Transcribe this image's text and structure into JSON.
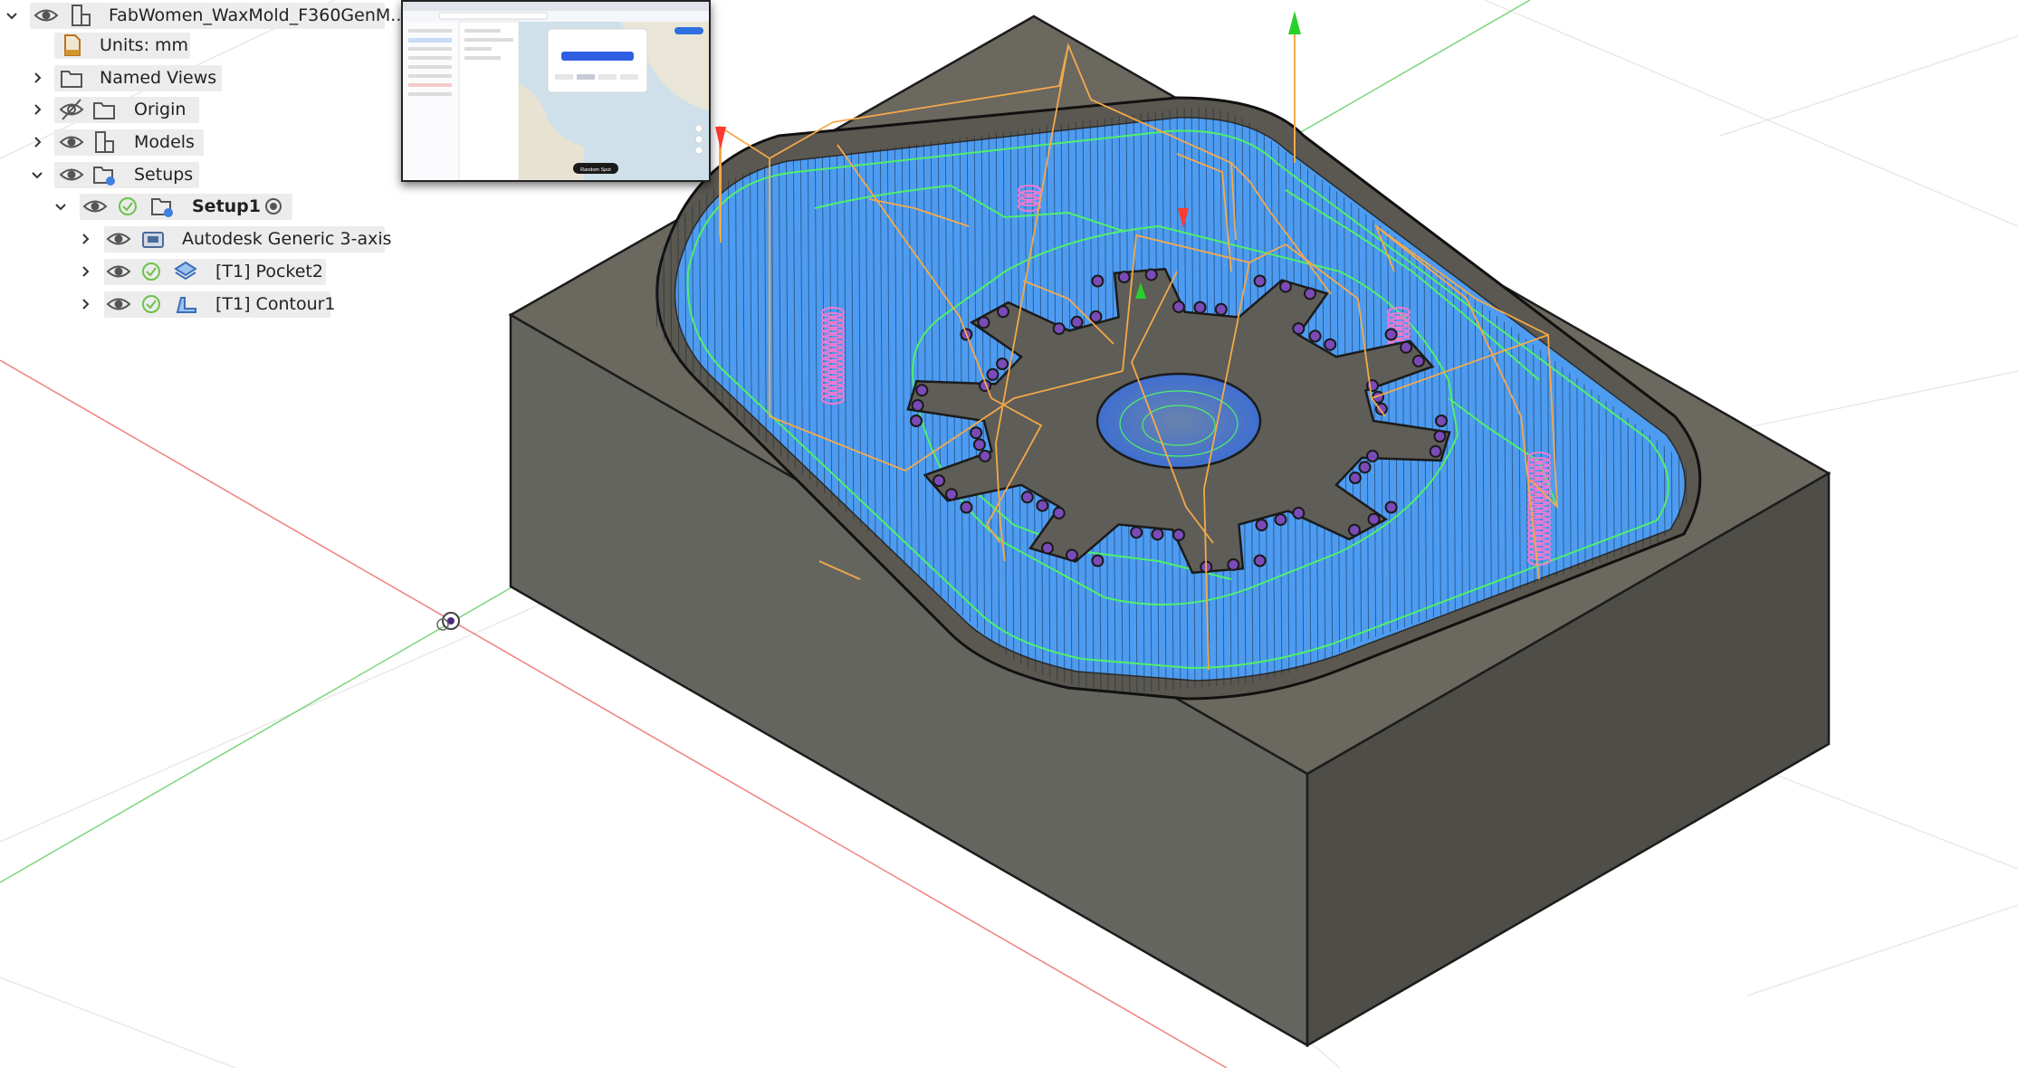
{
  "browser": {
    "document_name": "FabWomen_WaxMold_F360GenM...",
    "units": "Units: mm",
    "named_views": "Named Views",
    "origin": "Origin",
    "models": "Models",
    "setups": "Setups",
    "setup1": "Setup1",
    "machine": "Autodesk Generic 3-axis",
    "op1": "[T1] Pocket2",
    "op2": "[T1] Contour1"
  },
  "thumbnail": {
    "label": "Random Spot"
  },
  "colors": {
    "stock_left": "#656560",
    "stock_right": "#4e4d48",
    "stock_top": "#6b6860",
    "pocket": "#4d9cf2",
    "toolpath_green": "#4ff06a",
    "rapid_orange": "#f5a94a",
    "plunge_pink": "#f07ad0",
    "axis_red": "#ff5a5a",
    "axis_green": "#6ad86a"
  },
  "icons": [
    "eye-icon",
    "eye-hidden-icon",
    "component-icon",
    "folder-icon",
    "document-icon",
    "check-circle-icon",
    "setup-folder-icon",
    "radio-icon",
    "machine-icon",
    "pocket-op-icon",
    "contour-op-icon",
    "chevron-right-icon",
    "chevron-down-icon"
  ]
}
